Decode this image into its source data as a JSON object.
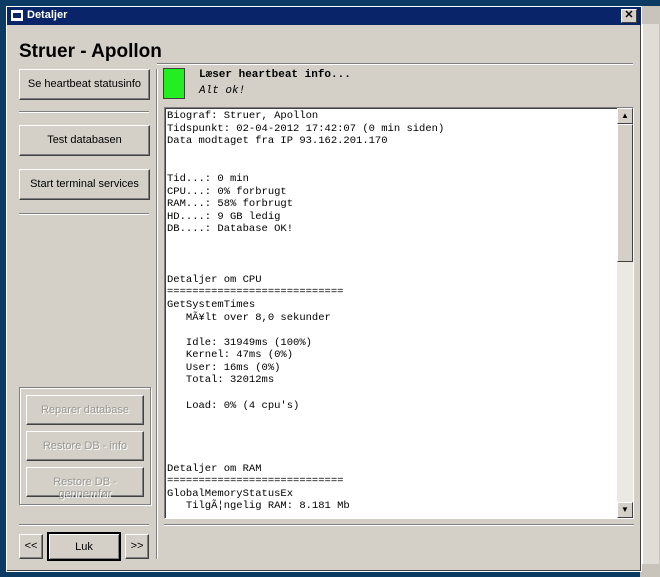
{
  "window": {
    "title": "Detaljer",
    "close_glyph": "✕"
  },
  "heading": "Struer - Apollon",
  "buttons": {
    "heartbeat": "Se heartbeat statusinfo",
    "test_db": "Test databasen",
    "terminal": "Start terminal services",
    "repair_db": "Reparer database",
    "restore_info": "Restore DB - info",
    "restore_run": "Restore DB - gennemfør",
    "prev": "<<",
    "close": "Luk",
    "next": ">>"
  },
  "status": {
    "title": "Læser heartbeat info...",
    "subtitle": "Alt ok!",
    "led_color": "#22ee22"
  },
  "output_text": "Biograf: Struer, Apollon\nTidspunkt: 02-04-2012 17:42:07 (0 min siden)\nData modtaget fra IP 93.162.201.170\n\n\nTid...: 0 min\nCPU...: 0% forbrugt\nRAM...: 58% forbrugt\nHD....: 9 GB ledig\nDB....: Database OK!\n\n\n\nDetaljer om CPU\n============================\nGetSystemTimes\n   MÃ¥lt over 8,0 sekunder\n\n   Idle: 31949ms (100%)\n   Kernel: 47ms (0%)\n   User: 16ms (0%)\n   Total: 32012ms\n\n   Load: 0% (4 cpu's)\n\n\n\n\nDetaljer om RAM\n============================\nGlobalMemoryStatusEx\n   TilgÃ¦ngelig RAM: 8.181 Mb",
  "scroll": {
    "up": "▲",
    "down": "▼"
  }
}
